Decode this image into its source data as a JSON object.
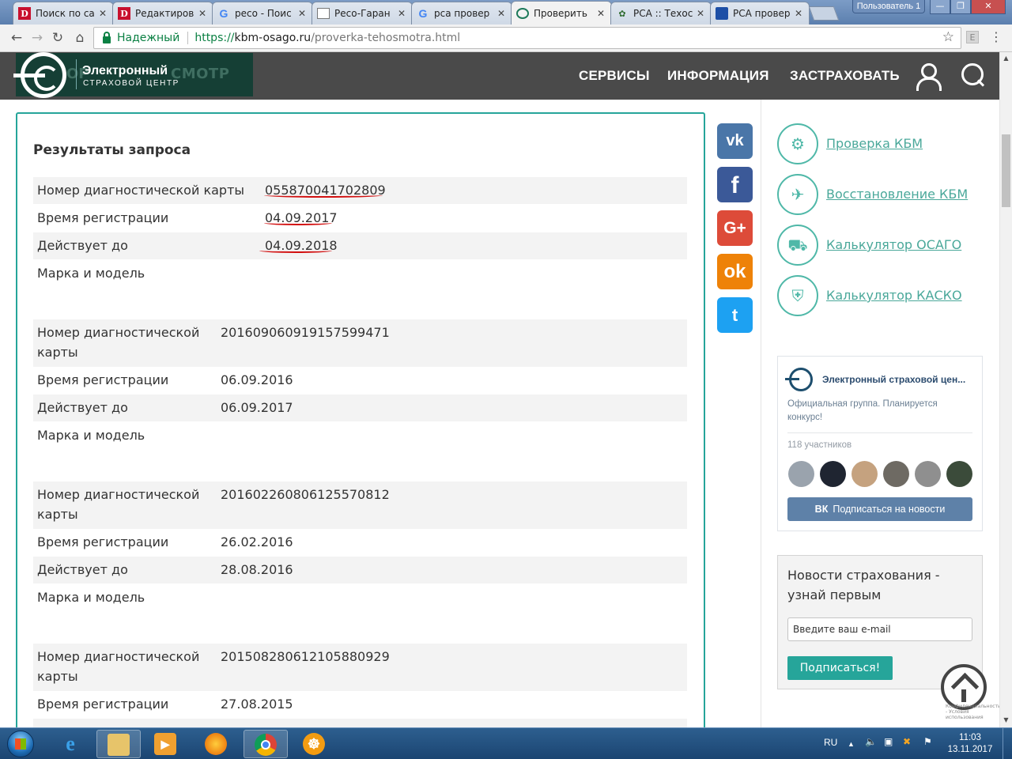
{
  "browser": {
    "tabs": [
      {
        "title": "Поиск по са",
        "favicon": "d-icon",
        "active": false
      },
      {
        "title": "Редактиров",
        "favicon": "d-icon",
        "active": false
      },
      {
        "title": "рeco - Поис",
        "favicon": "google-icon",
        "active": false
      },
      {
        "title": "Реco-Гаран",
        "favicon": "document-icon",
        "active": false
      },
      {
        "title": "рса провер",
        "favicon": "google-icon",
        "active": false
      },
      {
        "title": "Проверить",
        "favicon": "site-icon",
        "active": true
      },
      {
        "title": "РСА :: Техос",
        "favicon": "rsa-icon",
        "active": false
      },
      {
        "title": "РСА провер",
        "favicon": "car-icon",
        "active": false
      }
    ],
    "user_badge": "Пользователь 1",
    "secure_label": "Надежный",
    "url": {
      "scheme": "https://",
      "host": "kbm-osago.ru",
      "path": "/proverka-tehosmotra.html"
    },
    "extension_label": "E"
  },
  "header": {
    "logo_title": "Электронный",
    "logo_subtitle": "СТРАХОВОЙ ЦЕНТР",
    "logo_bg_left": "ОР",
    "logo_bg_right": "СМОТР",
    "nav": [
      "СЕРВИСЫ",
      "ИНФОРМАЦИЯ",
      "ЗАСТРАХОВАТЬ"
    ]
  },
  "results": {
    "title": "Результаты запроса",
    "labels": {
      "card_one_line": "Номер диагностической карты",
      "card_line1": "Номер диагностической",
      "card_line2": "карты",
      "registered": "Время регистрации",
      "valid_until": "Действует до",
      "make_model": "Марка и модель"
    },
    "records": [
      {
        "card_number": "055870041702809",
        "registered": "04.09.2017",
        "valid_until": "04.09.2018",
        "make_model": ""
      },
      {
        "card_number": "201609060919157599471",
        "registered": "06.09.2016",
        "valid_until": "06.09.2017",
        "make_model": ""
      },
      {
        "card_number": "201602260806125570812",
        "registered": "26.02.2016",
        "valid_until": "28.08.2016",
        "make_model": ""
      },
      {
        "card_number": "201508280612105880929",
        "registered": "27.08.2015"
      }
    ]
  },
  "social": [
    {
      "name": "vk",
      "glyph": "vk"
    },
    {
      "name": "facebook",
      "glyph": "f"
    },
    {
      "name": "google-plus",
      "glyph": "G+"
    },
    {
      "name": "odnoklassniki",
      "glyph": "ok"
    },
    {
      "name": "twitter",
      "glyph": "t"
    }
  ],
  "sidebar": {
    "services": [
      {
        "label": "Проверка КБМ",
        "icon": "car-check-icon"
      },
      {
        "label": "Восстановление КБМ",
        "icon": "restore-icon"
      },
      {
        "label": "Калькулятор ОСАГО",
        "icon": "calculator-icon"
      },
      {
        "label": "Калькулятор КАСКО",
        "icon": "shield-car-icon"
      }
    ],
    "vk_widget": {
      "name": "Электронный страховой цен...",
      "status": "Официальная группа. Планируется конкурс!",
      "members": "118 участников",
      "subscribe_logo": "ВК",
      "subscribe_label": "Подписаться на новости",
      "avatar_colors": [
        "#9aa3ad",
        "#1f2531",
        "#c5a27f",
        "#6e6a63",
        "#8f8f8f",
        "#3b4b3a"
      ]
    },
    "newsletter": {
      "title": "Новости страхования - узнай первым",
      "email_placeholder": "Введите ваш e-mail",
      "submit_label": "Подписаться!"
    },
    "recaptcha_text": "Конфиденциальность - Условия использования"
  },
  "taskbar": {
    "language": "RU",
    "time": "11:03",
    "date": "13.11.2017"
  },
  "colors": {
    "accent": "#26a59a",
    "header_bg": "#4a4a4a",
    "logo_bg": "#153f35",
    "underline_red": "#d21010"
  }
}
